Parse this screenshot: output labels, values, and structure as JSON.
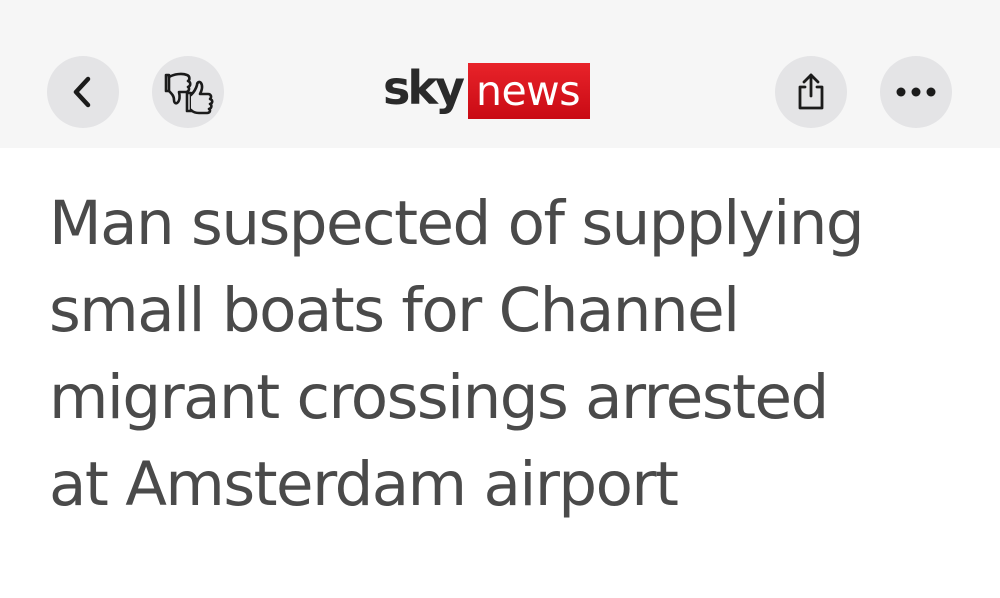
{
  "header": {
    "logo_left": "sky",
    "logo_right": "news",
    "brand_color": "#d0101a",
    "buttons": [
      {
        "icon": "chevron-left-icon"
      },
      {
        "icon": "thumbs-down-up-icon"
      },
      {
        "icon": "share-icon"
      },
      {
        "icon": "more-icon"
      }
    ]
  },
  "article": {
    "headline_lines": [
      "Man suspected of supplying",
      "small boats for Channel",
      "migrant crossings arrested",
      "at Amsterdam airport"
    ]
  }
}
